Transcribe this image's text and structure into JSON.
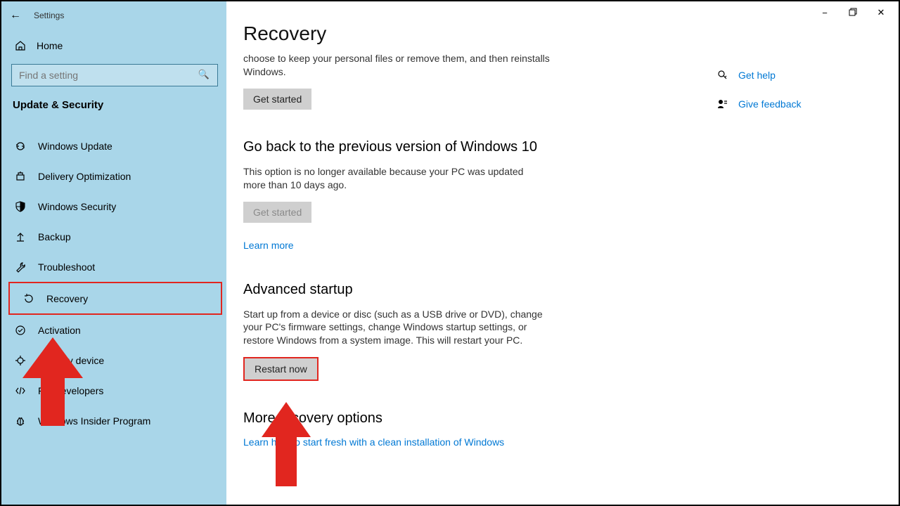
{
  "window": {
    "title": "Settings"
  },
  "sidebar": {
    "home": "Home",
    "search_placeholder": "Find a setting",
    "group": "Update & Security",
    "items": [
      {
        "icon": "↻",
        "label": "Windows Update"
      },
      {
        "icon": "⇪",
        "label": "Delivery Optimization"
      },
      {
        "icon": "🛡",
        "label": "Windows Security"
      },
      {
        "icon": "↑",
        "label": "Backup"
      },
      {
        "icon": "🛠",
        "label": "Troubleshoot"
      },
      {
        "icon": "⟳",
        "label": "Recovery",
        "selected": true
      },
      {
        "icon": "✓",
        "label": "Activation"
      },
      {
        "icon": "✱",
        "label": "Find my device"
      },
      {
        "icon": "{}",
        "label": "For developers"
      },
      {
        "icon": "🐞",
        "label": "Windows Insider Program"
      }
    ]
  },
  "main": {
    "title": "Recovery",
    "reset": {
      "desc_line": "choose to keep your personal files or remove them, and then reinstalls Windows.",
      "button": "Get started"
    },
    "goback": {
      "heading": "Go back to the previous version of Windows 10",
      "desc": "This option is no longer available because your PC was updated more than 10 days ago.",
      "button": "Get started",
      "learn_more": "Learn more"
    },
    "advanced": {
      "heading": "Advanced startup",
      "desc": "Start up from a device or disc (such as a USB drive or DVD), change your PC's firmware settings, change Windows startup settings, or restore Windows from a system image. This will restart your PC.",
      "button": "Restart now"
    },
    "more": {
      "heading": "More recovery options",
      "link": "Learn how to start fresh with a clean installation of Windows"
    }
  },
  "rail": {
    "get_help": "Get help",
    "give_feedback": "Give feedback"
  }
}
